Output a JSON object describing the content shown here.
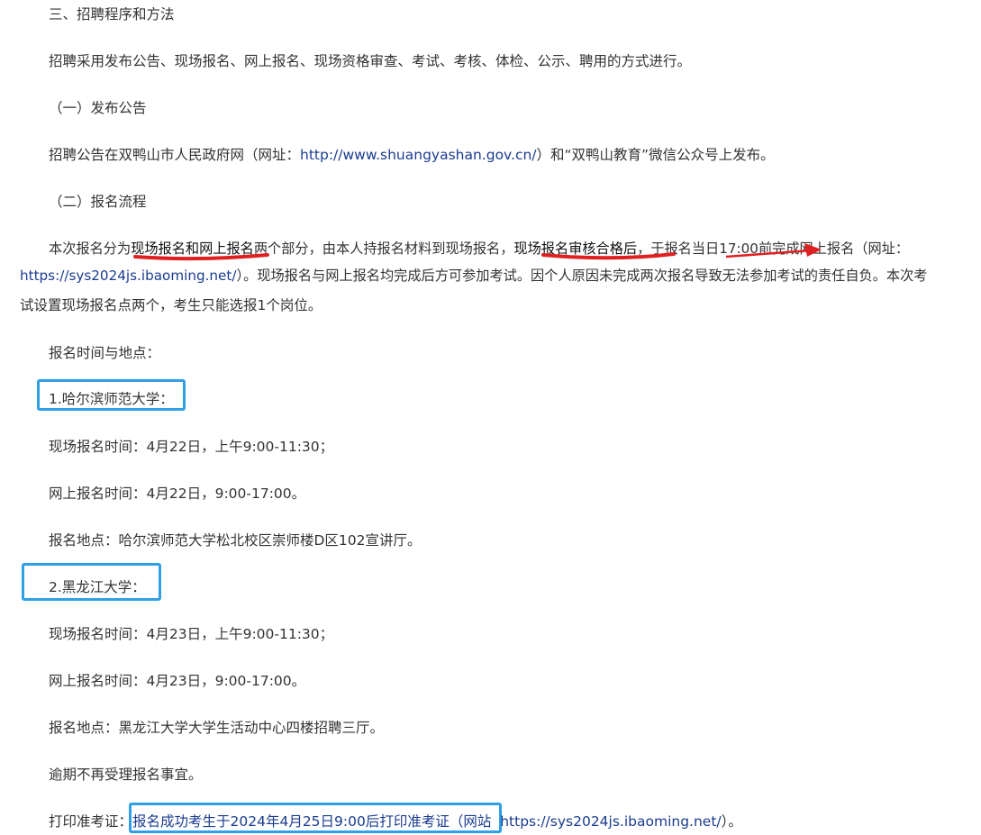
{
  "section_title": "三、招聘程序和方法",
  "intro": "招聘采用发布公告、现场报名、网上报名、现场资格审查、考试、考核、体检、公示、聘用的方式进行。",
  "sub1_title": "（一）发布公告",
  "announce": {
    "pre": "招聘公告在双鸭山市人民政府网（网址：",
    "url": "http://www.shuangyashan.gov.cn/",
    "post": "）和“双鸭山教育”微信公众号上发布。"
  },
  "sub2_title": "（二）报名流程",
  "process": {
    "p1": "本次报名分为",
    "p2": "现场报名和网上报名",
    "p3": "两个部分，由本人持报名材料到现场报名，",
    "p4": "现场报名审核合格后",
    "p5": "，于报名当日17:00前",
    "p6": "完成网上报名（网址：",
    "url": "https://sys2024js.ibaoming.net/",
    "p7": "）。现场报名与网上报名均完成后方可参加考试。因个人原因未完成两次报名导致无法参加考试的责任自负。本次考",
    "p8": "试设置现场报名点两个，考生只能选报1个岗位。"
  },
  "time_place_label": "报名时间与地点：",
  "site1": {
    "title": "1.哈尔滨师范大学：",
    "onsite": "现场报名时间：4月22日，上午9:00-11:30；",
    "online": "网上报名时间：4月22日，9:00-17:00。",
    "place": "报名地点：哈尔滨师范大学松北校区崇师楼D区102宣讲厅。"
  },
  "site2": {
    "title": "2.黑龙江大学：",
    "onsite": "现场报名时间：4月23日，上午9:00-11:30；",
    "online": "网上报名时间：4月23日，9:00-17:00。",
    "place": "报名地点：黑龙江大学大学生活动中心四楼招聘三厅。"
  },
  "overdue": "逾期不再受理报名事宜。",
  "print": {
    "label": "打印准考证：",
    "boxed": "报名成功考生于2024年4月25日9:00后打印准考证（网站",
    "url": "https://sys2024js.ibaoming.net/",
    "post": "）。"
  },
  "colors": {
    "text": "#333333",
    "link": "#1a3c8f",
    "red_annotation": "#e02020",
    "blue_box": "#2f9fe6"
  }
}
